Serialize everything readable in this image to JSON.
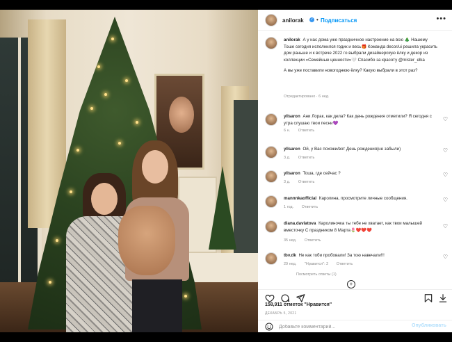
{
  "post": {
    "username": "anilorak",
    "verified_mark": "✓",
    "separator": "•",
    "follow_label": "Подписаться",
    "more_label": "•••"
  },
  "caption": {
    "username": "anilorak",
    "text": "А у нас дома уже праздничное настроение на всю 🎄 Нашему Тоше сегодня исполнился годик и весь🎁 Команда decor/ui решила украсить дом раньше и к встрече 2022 го выбрали дизайнерскую ёлку и декор из коллекции «Семейные ценности»🤍 Спасибо за красоту @mister_elka",
    "question": "А вы уже поставили новогоднюю ёлку? Какую выбрали в этот раз?",
    "meta": "Отредактировано · 6 нед."
  },
  "comments": [
    {
      "username": "yllsaron",
      "text": "Ани Лорак, как дела? Как день рождения отметили? Я сегодня с утра слушаю твои песни💜",
      "time": "6 н.",
      "reply": "Ответить"
    },
    {
      "username": "yllsaron",
      "text": "Ой, у Вас похожи/вот День рождения(не забыли)",
      "time": "3 д.",
      "reply": "Ответить"
    },
    {
      "username": "yllsaron",
      "text": "Тоша, где сейчас ?",
      "time": "3 д.",
      "reply": "Ответить"
    },
    {
      "username": "mannnkaofficial",
      "text": "Каролина, просмотрите личные сообщения.",
      "time": "1 год.",
      "reply": "Ответить"
    },
    {
      "username": "diana.davlatova",
      "text": "Каролиночка ты тебе не хватает, как твои малышей вместочку С праздником 8 Марта🌷❤️❤️❤️",
      "time": "35 нед.",
      "reply": "Ответить"
    },
    {
      "username": "tbv.dk",
      "text": "Не как тоби пробовали! За тою навечали!!!",
      "time": "29 нед.",
      "likes": "\"Нравится\": 2",
      "reply": "Ответить"
    }
  ],
  "view_more": "Посмотреть ответы (1)",
  "load_more": "+",
  "actions": {
    "likes_text": "158,911 отметок \"Нравится\"",
    "date": "ДЕКАБРЬ 5, 2021"
  },
  "composer": {
    "placeholder": "Добавьте комментарий...",
    "post_label": "Опубликовать"
  },
  "colors": {
    "link": "#0095f6",
    "verified": "#3897f0"
  }
}
